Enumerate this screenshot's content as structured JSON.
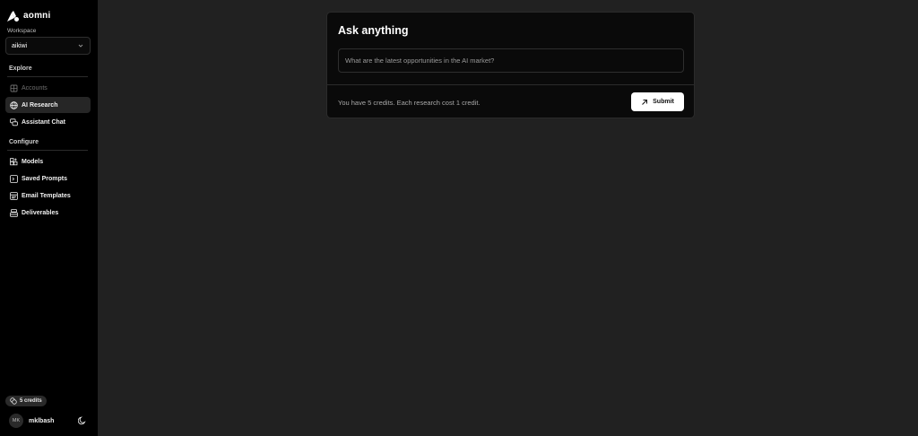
{
  "app": {
    "brand": "aomni"
  },
  "sidebar": {
    "workspace_label": "Workspace",
    "workspace_value": "aikiwi",
    "sections": [
      {
        "title": "Explore",
        "items": [
          {
            "label": "Accounts",
            "icon": "building-icon",
            "state": "disabled"
          },
          {
            "label": "AI Research",
            "icon": "globe-icon",
            "state": "active"
          },
          {
            "label": "Assistant Chat",
            "icon": "chat-icon",
            "state": "normal"
          }
        ]
      },
      {
        "title": "Configure",
        "items": [
          {
            "label": "Models",
            "icon": "grid-plus-icon",
            "state": "normal"
          },
          {
            "label": "Saved Prompts",
            "icon": "terminal-icon",
            "state": "normal"
          },
          {
            "label": "Email Templates",
            "icon": "template-icon",
            "state": "normal"
          },
          {
            "label": "Deliverables",
            "icon": "layers-icon",
            "state": "normal"
          }
        ]
      }
    ],
    "credits_badge": "5 credits",
    "user": {
      "initials": "MK",
      "name": "mklbash"
    }
  },
  "main": {
    "title": "Ask anything",
    "input_placeholder": "What are the latest opportunities in the AI market?",
    "credit_note": "You have 5 credits. Each research cost 1 credit.",
    "submit_label": "Submit"
  },
  "colors": {
    "sidebar_bg": "#000000",
    "main_bg": "#212121",
    "card_bg": "#0a0a0a",
    "active_item_bg": "#262626",
    "button_bg": "#ffffff"
  }
}
